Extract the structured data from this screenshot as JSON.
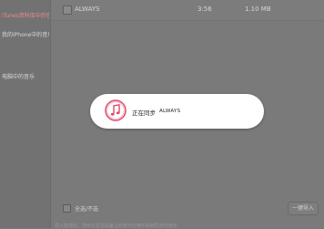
{
  "sidebar": {
    "items": [
      {
        "label": "iTunes资料库中的音乐",
        "active": true
      },
      {
        "label": "我的iPhone中的音乐",
        "active": false
      },
      {
        "label": "电脑中的音乐",
        "active": false
      }
    ]
  },
  "song_list": {
    "rows": [
      {
        "title": "ALWAYS",
        "duration": "3:56",
        "size": "1.10 MB"
      }
    ]
  },
  "bottom_bar": {
    "select_all_label": "全选/不选",
    "right_button_label": "一键导入"
  },
  "footer_text": "导入完成后，您可以在您设备上的音乐应用中找到同步的音乐",
  "toast": {
    "icon": "music-note-icon",
    "status_text": "正在同步",
    "track_name": "ALWAYS"
  },
  "colors": {
    "accent": "#e0486a",
    "overlay": "#7a7a7a",
    "toast_bg": "#ffffff"
  }
}
